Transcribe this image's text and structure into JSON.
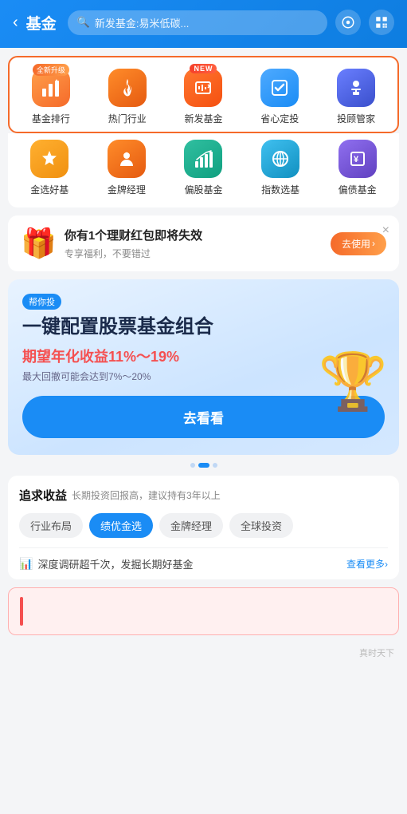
{
  "header": {
    "back_label": "‹",
    "title": "基金",
    "search_placeholder": "新发基金:易米低碳...",
    "search_icon": "search-icon",
    "settings_icon": "settings-icon",
    "qr_icon": "qr-icon"
  },
  "nav_row1": [
    {
      "id": "fund-rank",
      "label": "基金排行",
      "badge": "全新升级",
      "badge_type": "normal",
      "color": "orange",
      "icon": "rank"
    },
    {
      "id": "hot-sector",
      "label": "热门行业",
      "badge": null,
      "badge_type": null,
      "color": "orange2",
      "icon": "fire"
    },
    {
      "id": "new-fund",
      "label": "新发基金",
      "badge": "NEW",
      "badge_type": "new",
      "color": "orange3",
      "icon": "new"
    },
    {
      "id": "auto-invest",
      "label": "省心定投",
      "badge": null,
      "badge_type": null,
      "color": "blue",
      "icon": "check"
    },
    {
      "id": "advisor",
      "label": "投顾管家",
      "badge": null,
      "badge_type": null,
      "color": "indigo",
      "icon": "suit"
    }
  ],
  "nav_row2": [
    {
      "id": "selected",
      "label": "金选好基",
      "badge": null,
      "color": "amber",
      "icon": "star"
    },
    {
      "id": "star-manager",
      "label": "金牌经理",
      "badge": null,
      "color": "orange2",
      "icon": "medal"
    },
    {
      "id": "mixed-fund",
      "label": "偏股基金",
      "badge": null,
      "color": "teal",
      "icon": "chart"
    },
    {
      "id": "index-fund",
      "label": "指数选基",
      "badge": null,
      "color": "sky",
      "icon": "hash"
    },
    {
      "id": "bond-fund",
      "label": "偏债基金",
      "badge": null,
      "color": "purple",
      "icon": "money"
    }
  ],
  "promo": {
    "title": "你有1个理财红包即将失效",
    "subtitle": "专享福利，不要错过",
    "btn_label": "去使用",
    "btn_arrow": "›",
    "close_label": "×"
  },
  "invest_card": {
    "tag": "帮你投",
    "main_title": "一键配置股票基金组合",
    "yield_label": "期望年化收益",
    "yield_value": "11%～19%",
    "note": "最大回撤可能会达到7%～20%",
    "cta_label": "去看看",
    "dots": [
      false,
      true,
      false
    ]
  },
  "tabs": {
    "section_title": "追求收益",
    "section_subtitle": "长期投资回报高，建议持有3年以上",
    "pills": [
      {
        "id": "sector",
        "label": "行业布局",
        "active": false
      },
      {
        "id": "top-picks",
        "label": "绩优金选",
        "active": true
      },
      {
        "id": "star-manager",
        "label": "金牌经理",
        "active": false
      },
      {
        "id": "global",
        "label": "全球投资",
        "active": false
      }
    ],
    "info_text": "深度调研超千次，发掘长期好基金",
    "info_link": "查看更多",
    "info_arrow": "›"
  },
  "bottom_hint": {
    "text": ""
  },
  "watermark": "真时天下"
}
